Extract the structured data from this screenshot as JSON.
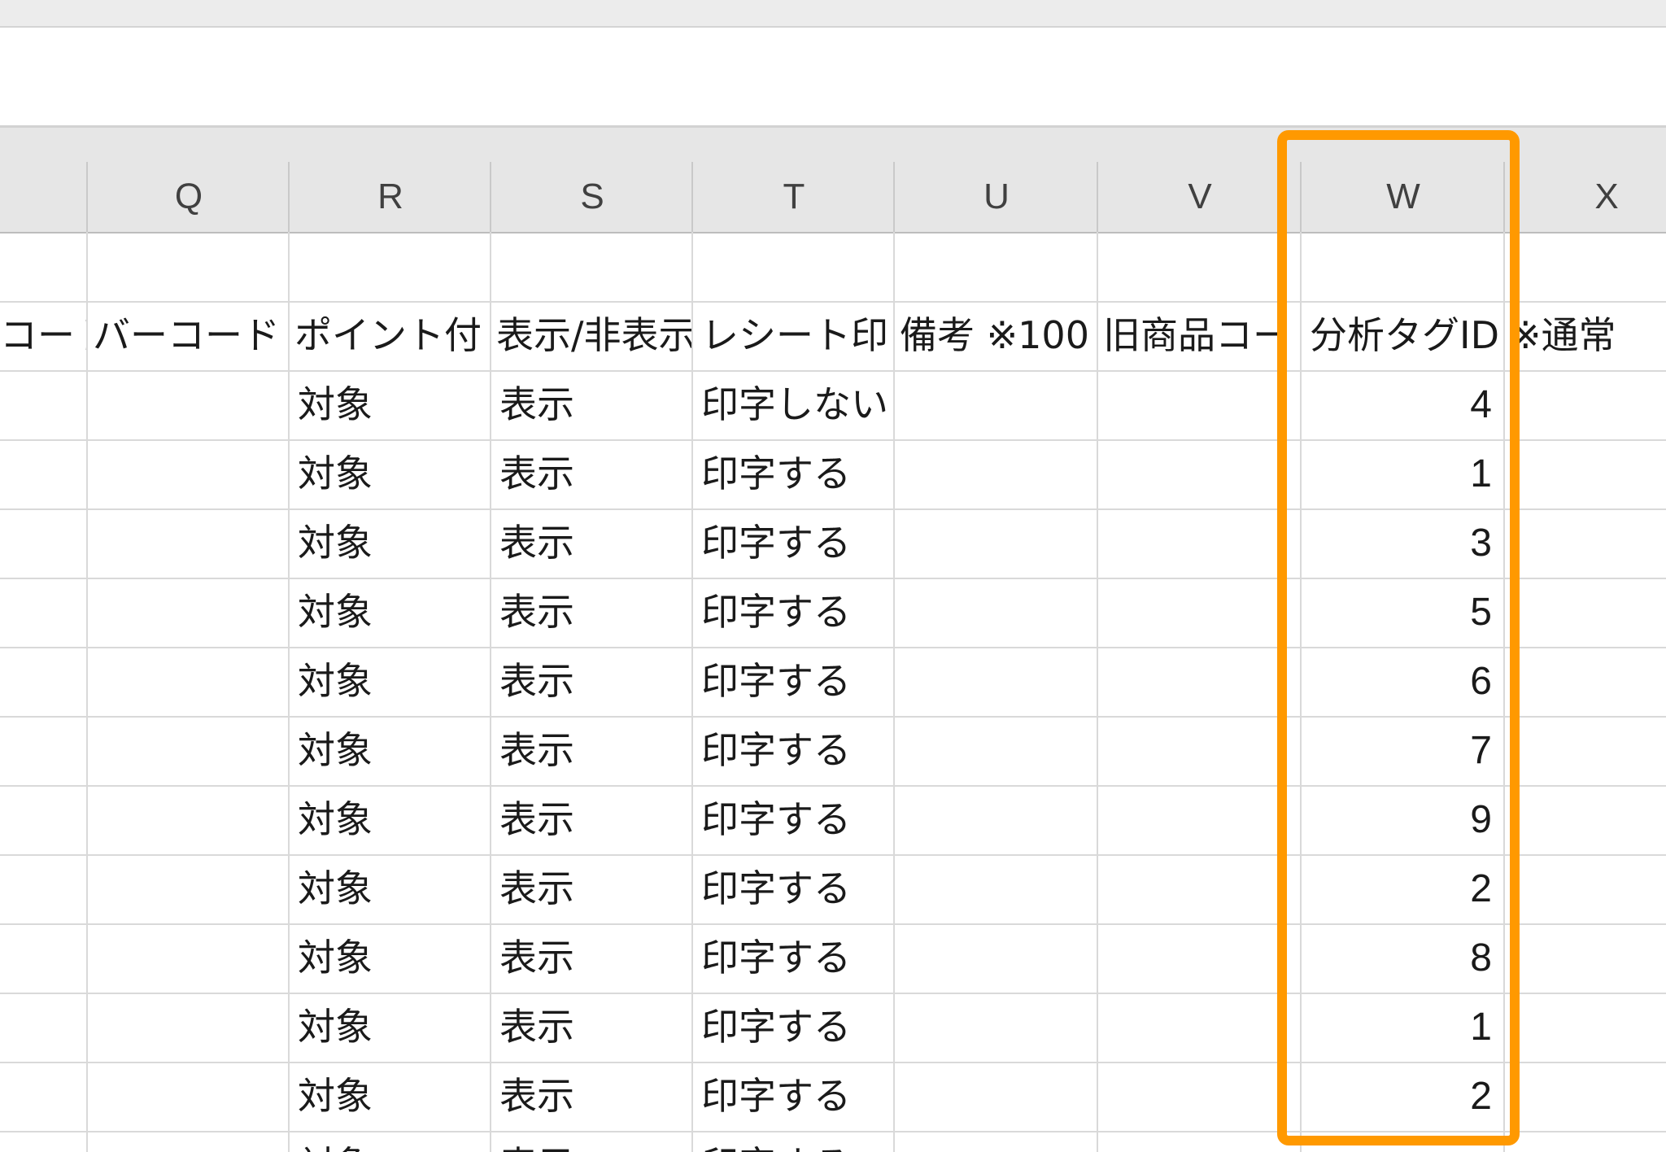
{
  "colors": {
    "highlight": "#ff9900",
    "header_bg": "#e6e6e6",
    "grid_line": "#d9d9d9"
  },
  "columns": [
    {
      "id": "P",
      "label": ""
    },
    {
      "id": "Q",
      "label": "Q"
    },
    {
      "id": "R",
      "label": "R"
    },
    {
      "id": "S",
      "label": "S"
    },
    {
      "id": "T",
      "label": "T"
    },
    {
      "id": "U",
      "label": "U"
    },
    {
      "id": "V",
      "label": "V"
    },
    {
      "id": "W",
      "label": "W"
    },
    {
      "id": "X",
      "label": "X"
    }
  ],
  "header_row": [
    "コード",
    "バーコード",
    "ポイント付",
    "表示/非表示",
    "レシート印",
    "備考 ※100",
    "旧商品コード",
    "分析タグID",
    "※通常"
  ],
  "rows": [
    {
      "R": "対象",
      "S": "表示",
      "T": "印字しない",
      "W": "4"
    },
    {
      "R": "対象",
      "S": "表示",
      "T": "印字する",
      "W": "1"
    },
    {
      "R": "対象",
      "S": "表示",
      "T": "印字する",
      "W": "3"
    },
    {
      "R": "対象",
      "S": "表示",
      "T": "印字する",
      "W": "5"
    },
    {
      "R": "対象",
      "S": "表示",
      "T": "印字する",
      "W": "6"
    },
    {
      "R": "対象",
      "S": "表示",
      "T": "印字する",
      "W": "7"
    },
    {
      "R": "対象",
      "S": "表示",
      "T": "印字する",
      "W": "9"
    },
    {
      "R": "対象",
      "S": "表示",
      "T": "印字する",
      "W": "2"
    },
    {
      "R": "対象",
      "S": "表示",
      "T": "印字する",
      "W": "8"
    },
    {
      "R": "対象",
      "S": "表示",
      "T": "印字する",
      "W": "1"
    },
    {
      "R": "対象",
      "S": "表示",
      "T": "印字する",
      "W": "2"
    },
    {
      "R": "対象",
      "S": "表示",
      "T": "印字する",
      "W": ""
    }
  ]
}
